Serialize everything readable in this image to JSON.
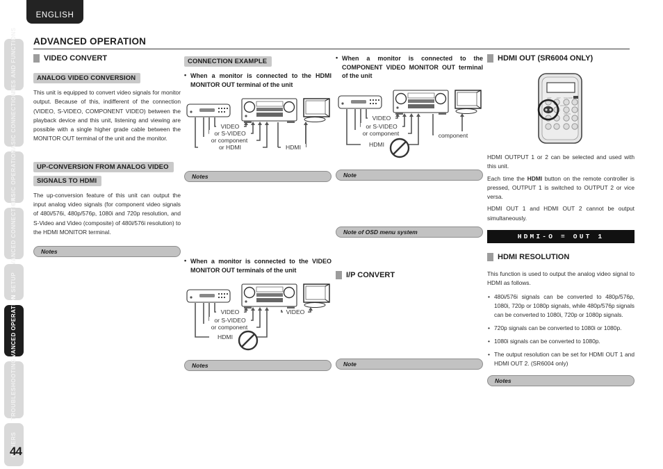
{
  "lang_tab": {
    "label": "ENGLISH"
  },
  "page_number": "44",
  "sidebar": {
    "items": [
      {
        "label": "NAMES AND FUNCTIONS",
        "line1": "NAMES AND",
        "line2": "FUNCTIONS",
        "active": false
      },
      {
        "label": "BASIC CONNECTIONS",
        "line1": "BASIC",
        "line2": "CONNECTIONS",
        "active": false
      },
      {
        "label": "BASIC OPERATION",
        "line1": "BASIC",
        "line2": "OPERATION",
        "active": false
      },
      {
        "label": "ADVANCED CONNECTIONS",
        "line1": "ADVANCED",
        "line2": "CONNECTIONS",
        "active": false
      },
      {
        "label": "SETUP",
        "line1": "SETUP",
        "line2": "",
        "active": false
      },
      {
        "label": "ADVANCED OPERATION",
        "line1": "ADVANCED",
        "line2": "OPERATION",
        "active": true
      },
      {
        "label": "TROUBLESHOOTING",
        "line1": "TROUBLESHOOTING",
        "line2": "",
        "active": false
      },
      {
        "label": "OTHERS",
        "line1": "OTHERS",
        "line2": "",
        "active": false
      }
    ]
  },
  "header": {
    "title": "ADVANCED OPERATION"
  },
  "col1": {
    "section_title": "VIDEO CONVERT",
    "sub1_title": "ANALOG VIDEO CONVERSION",
    "sub1_body": "This unit is equipped to convert video signals for monitor output. Because of this, indifferent of the connection (VIDEO, S-VIDEO, COMPONENT VIDEO) between the playback device and this unit, listening and viewing are possible with a single higher grade cable between the MONITOR OUT terminal of the unit and the monitor.",
    "sub2_title_line1": "UP-CONVERSION FROM ANALOG VIDEO",
    "sub2_title_line2": "SIGNALS TO HDMI",
    "sub2_body": "The up-conversion feature of this unit can output the input analog video signals (for component video signals of 480i/576i, 480p/576p, 1080i and 720p resolution, and S-Video and Video (composite) of 480i/576i resolution) to the HDMI MONITOR terminal.",
    "notes_label": "Notes"
  },
  "col2": {
    "sub_title": "CONNECTION EXAMPLE",
    "item1_heading": "When a monitor is connected to the HDMI MONITOR OUT terminal of the unit",
    "item1_labels": {
      "video": "VIDEO",
      "svideo": "or S-VIDEO",
      "component": "or component",
      "hdmi": "or HDMI",
      "out": "HDMI"
    },
    "notes1_label": "Notes",
    "item2_heading": "When a monitor is connected to the VIDEO MONITOR OUT terminals of the unit",
    "item2_labels": {
      "video": "VIDEO",
      "svideo": "or S-VIDEO",
      "component": "or component",
      "hdmi": "HDMI",
      "out": "VIDEO"
    },
    "notes2_label": "Notes"
  },
  "col3": {
    "item1_heading": "When a monitor is connected to the COMPONENT VIDEO MONITOR OUT terminal of the unit",
    "item1_labels": {
      "video": "VIDEO",
      "svideo": "or S-VIDEO",
      "component": "or component",
      "hdmi": "HDMI",
      "out": "component"
    },
    "note1_label": "Note",
    "note2_label": "Note of OSD menu system",
    "section_title": "I/P CONVERT",
    "note3_label": "Note"
  },
  "col4": {
    "section_title": "HDMI OUT (SR6004 ONLY)",
    "body_line1": "HDMI OUTPUT 1 or 2 can be selected and used with this unit.",
    "body_line2_pre": "Each time the ",
    "body_line2_bold": "HDMI",
    "body_line2_post": " button on the remote controller is pressed, OUTPUT 1 is switched to OUTPUT 2 or vice versa.",
    "body_line3": "HDMI OUT 1 and HDMI OUT 2 cannot be output simultaneously.",
    "lcd_text": "HDMI-O  =  OUT 1",
    "section2_title": "HDMI RESOLUTION",
    "section2_intro": "This function is used to output the analog video signal to HDMI as follows.",
    "bullets": [
      "480i/576i signals can be converted to 480p/576p, 1080i, 720p or 1080p signals, while 480p/576p signals can be converted to 1080i, 720p or 1080p signals.",
      "720p signals can be converted to 1080i or 1080p.",
      "1080i signals can be converted to 1080p.",
      "The output resolution can be set for HDMI OUT 1 and HDMI OUT 2. (SR6004 only)"
    ],
    "notes_label": "Notes"
  },
  "colors": {
    "accent_dark": "#1d1d1d",
    "heading_grey": "#c9c9c9",
    "note_fill": "#c2c2c2",
    "note_border": "#8d8d8d",
    "tab_inactive": "#d9d9d9",
    "lcd_bg": "#111111"
  }
}
